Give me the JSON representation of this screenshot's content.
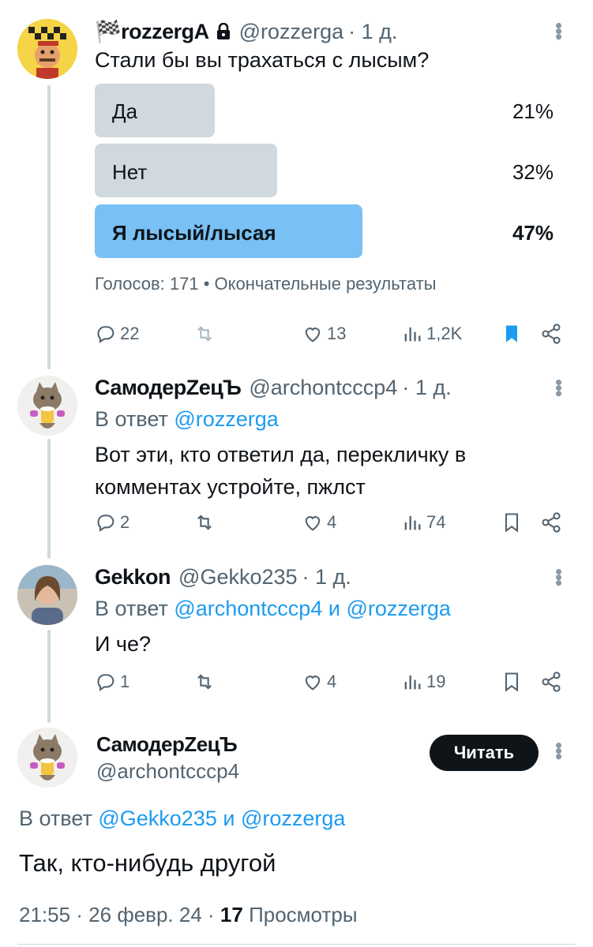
{
  "tweet1": {
    "name": "🏁rozzergA",
    "handle": "@rozzerga",
    "time": "· 1 д.",
    "text": "Стали бы вы трахаться с лысым?",
    "poll": {
      "options": [
        {
          "label": "Да",
          "pct": "21%",
          "value": 21
        },
        {
          "label": "Нет",
          "pct": "32%",
          "value": 32
        },
        {
          "label": "Я лысый/лысая",
          "pct": "47%",
          "value": 47
        }
      ],
      "footer": "Голосов: 171 • Окончательные результаты"
    },
    "actions": {
      "replies": "22",
      "retweets": "",
      "likes": "13",
      "views": "1,2K"
    }
  },
  "tweet2": {
    "name": "СамодерZецЪ",
    "handle": "@archontcccp4",
    "time": "· 1 д.",
    "reply_prefix": "В ответ",
    "reply_to": "@rozzerga",
    "text": "Вот эти, кто ответил да, перекличку в комментах устройте, пжлст",
    "actions": {
      "replies": "2",
      "retweets": "",
      "likes": "4",
      "views": "74"
    }
  },
  "tweet3": {
    "name": "Gekkon",
    "handle": "@Gekko235",
    "time": "· 1 д.",
    "reply_prefix": "В ответ",
    "reply_to_1": "@archontcccp4",
    "reply_and": "и",
    "reply_to_2": "@rozzerga",
    "text": "И че?",
    "actions": {
      "replies": "1",
      "retweets": "",
      "likes": "4",
      "views": "19"
    }
  },
  "main": {
    "name": "СамодерZецЪ",
    "handle": "@archontcccp4",
    "follow_label": "Читать",
    "reply_prefix": "В ответ",
    "reply_to_1": "@Gekko235",
    "reply_and": "и",
    "reply_to_2": "@rozzerga",
    "text": "Так, кто-нибудь другой",
    "timestamp": "21:55 · 26 февр. 24 ·",
    "views_count": "17",
    "views_label": "Просмотры"
  },
  "colors": {
    "accent": "#1d9bf0",
    "poll_winner": "#79c0f5",
    "poll_bar": "#cfd9de",
    "bookmark_active": "#1d9bf0"
  }
}
